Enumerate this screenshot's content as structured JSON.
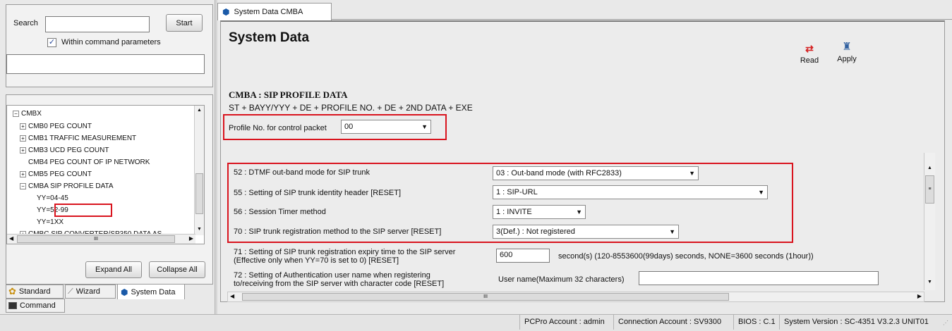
{
  "search": {
    "label": "Search",
    "value": "",
    "start_button": "Start",
    "within_checkbox_label": "Within command parameters",
    "within_checked": true
  },
  "tree": {
    "items": [
      {
        "label": "CMBX",
        "expander": "-"
      },
      {
        "label": "CMB0 PEG COUNT",
        "expander": "+"
      },
      {
        "label": "CMB1 TRAFFIC MEASUREMENT",
        "expander": "+"
      },
      {
        "label": "CMB3 UCD PEG COUNT",
        "expander": "+"
      },
      {
        "label": "CMB4 PEG COUNT OF IP NETWORK",
        "expander": ""
      },
      {
        "label": "CMB5 PEG COUNT",
        "expander": "+"
      },
      {
        "label": "CMBA SIP PROFILE DATA",
        "expander": "-"
      },
      {
        "label": "YY=04-45",
        "expander": ""
      },
      {
        "label": "YY=52-99",
        "expander": ""
      },
      {
        "label": "YY=1XX",
        "expander": ""
      },
      {
        "label": "CMBC SIP CONVERTER/SP350 DATA AS",
        "expander": "+"
      }
    ],
    "hscroll_thumb": "III",
    "expand_all": "Expand All",
    "collapse_all": "Collapse All"
  },
  "bottom_tabs": {
    "standard": "Standard",
    "wizard": "Wizard",
    "system_data": "System Data",
    "command": "Command"
  },
  "doc_tab": "System Data CMBA",
  "toolbar": {
    "read": "Read",
    "apply": "Apply"
  },
  "page": {
    "title": "System Data",
    "section_title": "CMBA : SIP PROFILE DATA",
    "command_format": "ST + BAYY/YYY + DE + PROFILE NO. + DE + 2ND DATA + EXE",
    "profile_label": "Profile No. for control packet",
    "profile_value": "00"
  },
  "params": [
    {
      "label": "52 : DTMF out-band mode for SIP trunk",
      "value": "03 : Out-band mode (with RFC2833)"
    },
    {
      "label": "55 : Setting of SIP trunk identity header [RESET]",
      "value": "1 : SIP-URL"
    },
    {
      "label": "56 : Session Timer method",
      "value": "1 : INVITE"
    },
    {
      "label": "70 : SIP trunk registration method to the SIP server [RESET]",
      "value": "3(Def.) : Not registered"
    },
    {
      "label_line1": "71 : Setting of SIP trunk registration expiry time to the SIP server",
      "label_line2": "(Effective only when YY=70 is set to 0) [RESET]",
      "value": "600",
      "hint": "second(s) (120-8553600(99days) seconds, NONE=3600 seconds (1hour))"
    },
    {
      "label_line1": "72 : Setting of Authentication user name when registering",
      "label_line2": "to/receiving from the SIP server with character code  [RESET]",
      "field_label": "User name(Maximum 32 characters)",
      "value": ""
    }
  ],
  "hscroll_thumb": "III",
  "status": {
    "account": "PCPro Account : admin",
    "connection": "Connection Account : SV9300",
    "bios": "BIOS : C.1",
    "version": "System Version : SC-4351 V3.2.3 UNIT01"
  },
  "colors": {
    "highlight": "#d9141e",
    "read_icon": "#d42020",
    "apply_icon": "#3060a0"
  }
}
